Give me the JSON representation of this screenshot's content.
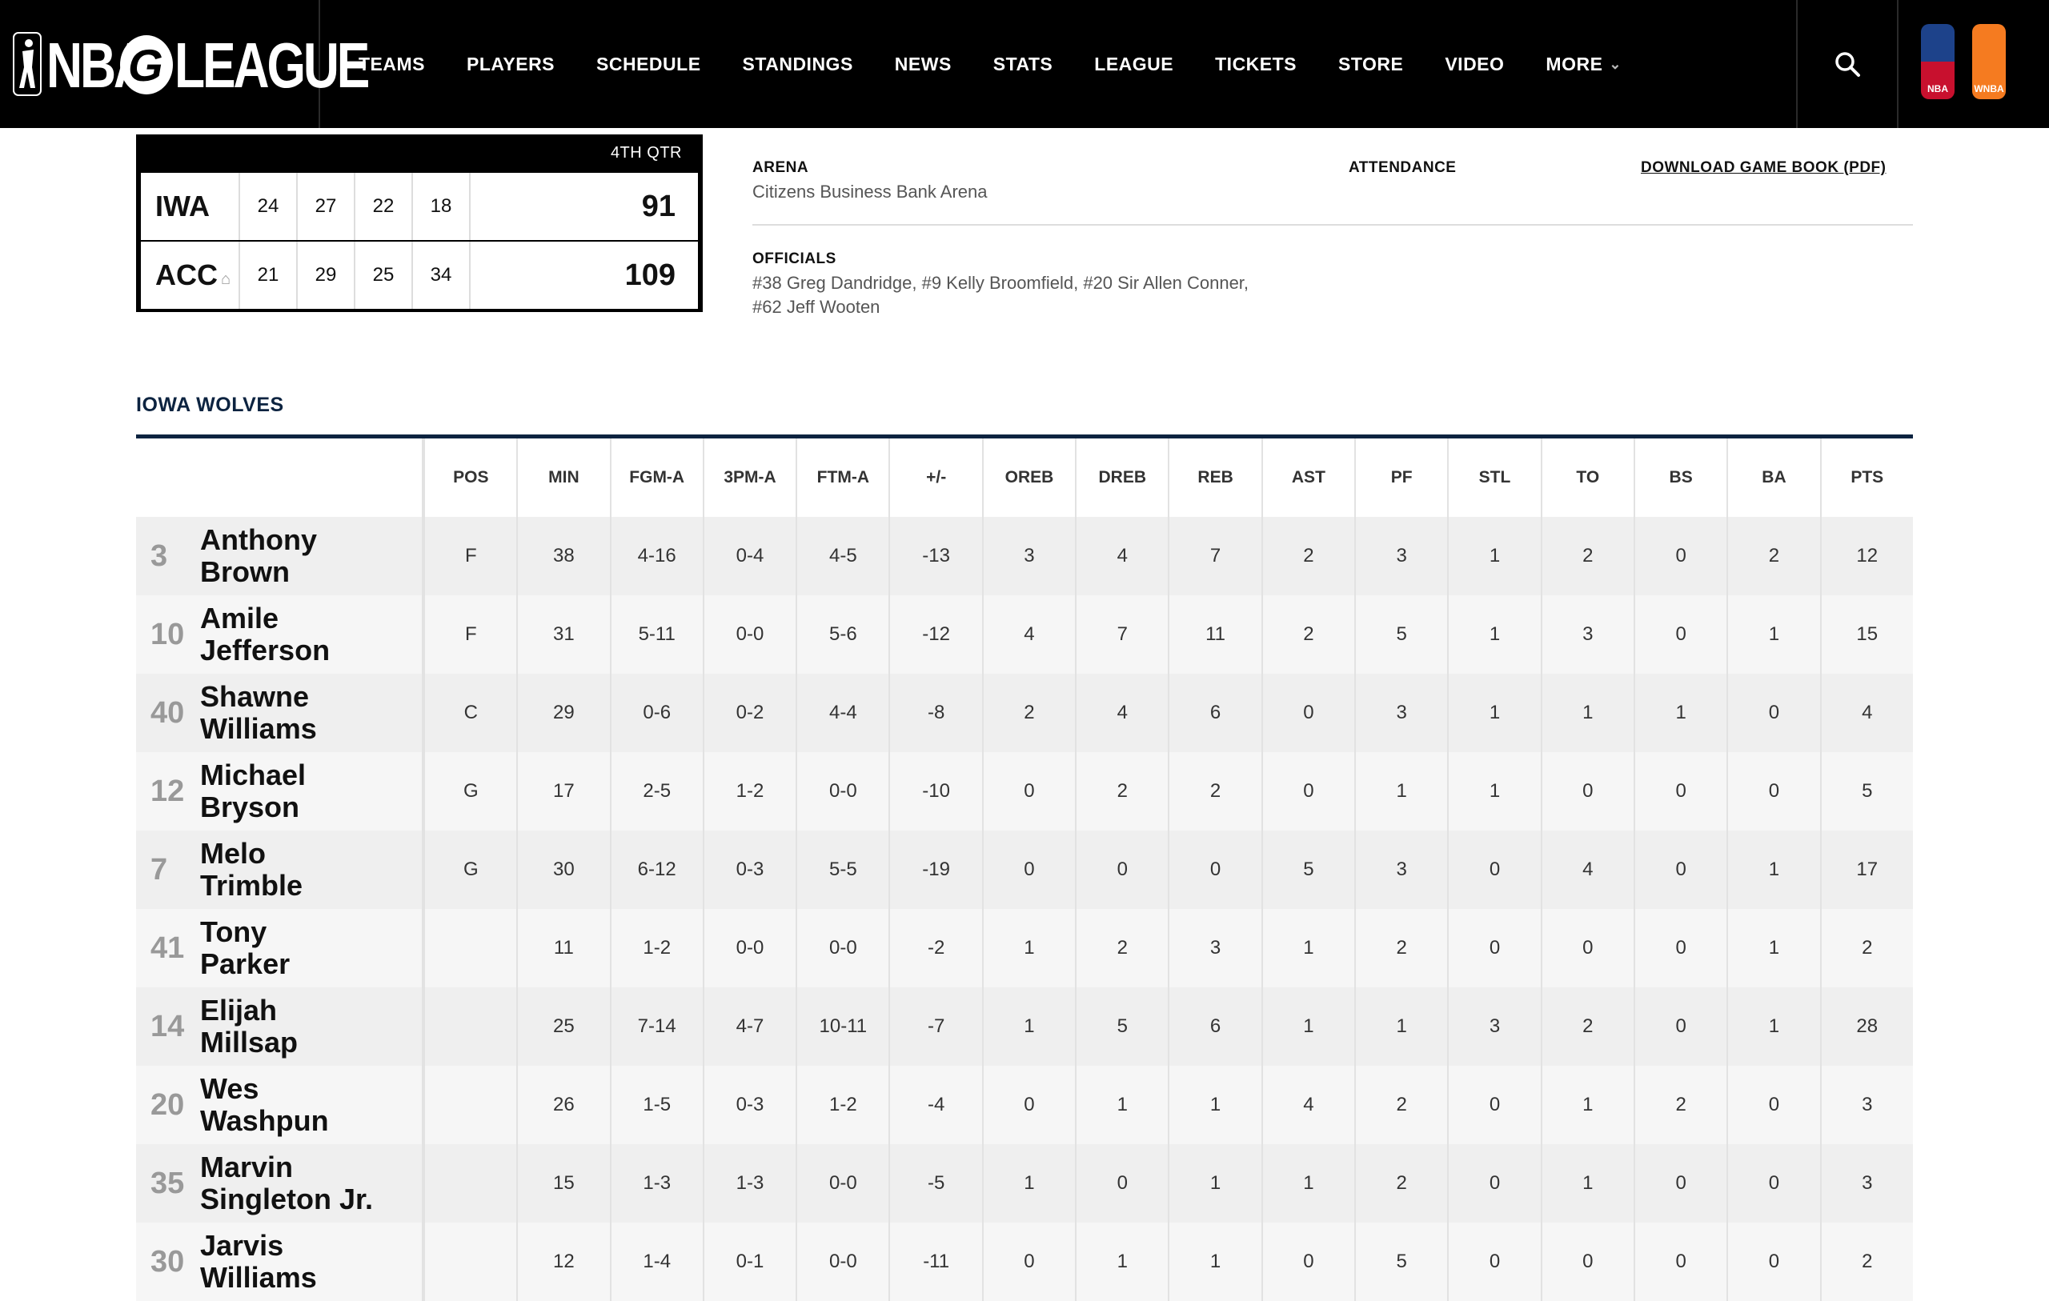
{
  "nav": {
    "logo_left": "NBA",
    "logo_g": "G",
    "logo_right": "LEAGUE",
    "items": [
      "TEAMS",
      "PLAYERS",
      "SCHEDULE",
      "STANDINGS",
      "NEWS",
      "STATS",
      "LEAGUE",
      "TICKETS",
      "STORE",
      "VIDEO",
      "MORE"
    ],
    "brand_nba": "NBA",
    "brand_wnba": "WNBA"
  },
  "scoreboard": {
    "period": "4TH QTR",
    "teams": [
      {
        "abbr": "IWA",
        "quarters": [
          "24",
          "27",
          "22",
          "18"
        ],
        "total": "91",
        "home": false
      },
      {
        "abbr": "ACC",
        "quarters": [
          "21",
          "29",
          "25",
          "34"
        ],
        "total": "109",
        "home": true
      }
    ]
  },
  "game_info": {
    "arena_label": "ARENA",
    "arena_value": "Citizens Business Bank Arena",
    "attendance_label": "ATTENDANCE",
    "gamebook_label": "DOWNLOAD GAME BOOK (PDF)",
    "officials_label": "OFFICIALS",
    "officials_line1": "#38 Greg Dandridge, #9 Kelly Broomfield, #20 Sir Allen Conner,",
    "officials_line2": "#62 Jeff Wooten"
  },
  "team_table": {
    "team_name": "IOWA WOLVES",
    "columns": [
      "POS",
      "MIN",
      "FGM-A",
      "3PM-A",
      "FTM-A",
      "+/-",
      "OREB",
      "DREB",
      "REB",
      "AST",
      "PF",
      "STL",
      "TO",
      "BS",
      "BA",
      "PTS"
    ],
    "rows": [
      {
        "num": "3",
        "first": "Anthony",
        "last": "Brown",
        "stats": [
          "F",
          "38",
          "4-16",
          "0-4",
          "4-5",
          "-13",
          "3",
          "4",
          "7",
          "2",
          "3",
          "1",
          "2",
          "0",
          "2",
          "12"
        ]
      },
      {
        "num": "10",
        "first": "Amile",
        "last": "Jefferson",
        "stats": [
          "F",
          "31",
          "5-11",
          "0-0",
          "5-6",
          "-12",
          "4",
          "7",
          "11",
          "2",
          "5",
          "1",
          "3",
          "0",
          "1",
          "15"
        ]
      },
      {
        "num": "40",
        "first": "Shawne",
        "last": "Williams",
        "stats": [
          "C",
          "29",
          "0-6",
          "0-2",
          "4-4",
          "-8",
          "2",
          "4",
          "6",
          "0",
          "3",
          "1",
          "1",
          "1",
          "0",
          "4"
        ]
      },
      {
        "num": "12",
        "first": "Michael",
        "last": "Bryson",
        "stats": [
          "G",
          "17",
          "2-5",
          "1-2",
          "0-0",
          "-10",
          "0",
          "2",
          "2",
          "0",
          "1",
          "1",
          "0",
          "0",
          "0",
          "5"
        ]
      },
      {
        "num": "7",
        "first": "Melo",
        "last": "Trimble",
        "stats": [
          "G",
          "30",
          "6-12",
          "0-3",
          "5-5",
          "-19",
          "0",
          "0",
          "0",
          "5",
          "3",
          "0",
          "4",
          "0",
          "1",
          "17"
        ]
      },
      {
        "num": "41",
        "first": "Tony",
        "last": "Parker",
        "stats": [
          "",
          "11",
          "1-2",
          "0-0",
          "0-0",
          "-2",
          "1",
          "2",
          "3",
          "1",
          "2",
          "0",
          "0",
          "0",
          "1",
          "2"
        ]
      },
      {
        "num": "14",
        "first": "Elijah",
        "last": "Millsap",
        "stats": [
          "",
          "25",
          "7-14",
          "4-7",
          "10-11",
          "-7",
          "1",
          "5",
          "6",
          "1",
          "1",
          "3",
          "2",
          "0",
          "1",
          "28"
        ]
      },
      {
        "num": "20",
        "first": "Wes",
        "last": "Washpun",
        "stats": [
          "",
          "26",
          "1-5",
          "0-3",
          "1-2",
          "-4",
          "0",
          "1",
          "1",
          "4",
          "2",
          "0",
          "1",
          "2",
          "0",
          "3"
        ]
      },
      {
        "num": "35",
        "first": "Marvin",
        "last": "Singleton Jr.",
        "stats": [
          "",
          "15",
          "1-3",
          "1-3",
          "0-0",
          "-5",
          "1",
          "0",
          "1",
          "1",
          "2",
          "0",
          "1",
          "0",
          "0",
          "3"
        ]
      },
      {
        "num": "30",
        "first": "Jarvis",
        "last": "Williams",
        "stats": [
          "",
          "12",
          "1-4",
          "0-1",
          "0-0",
          "-11",
          "0",
          "1",
          "1",
          "0",
          "5",
          "0",
          "0",
          "0",
          "0",
          "2"
        ]
      }
    ]
  }
}
